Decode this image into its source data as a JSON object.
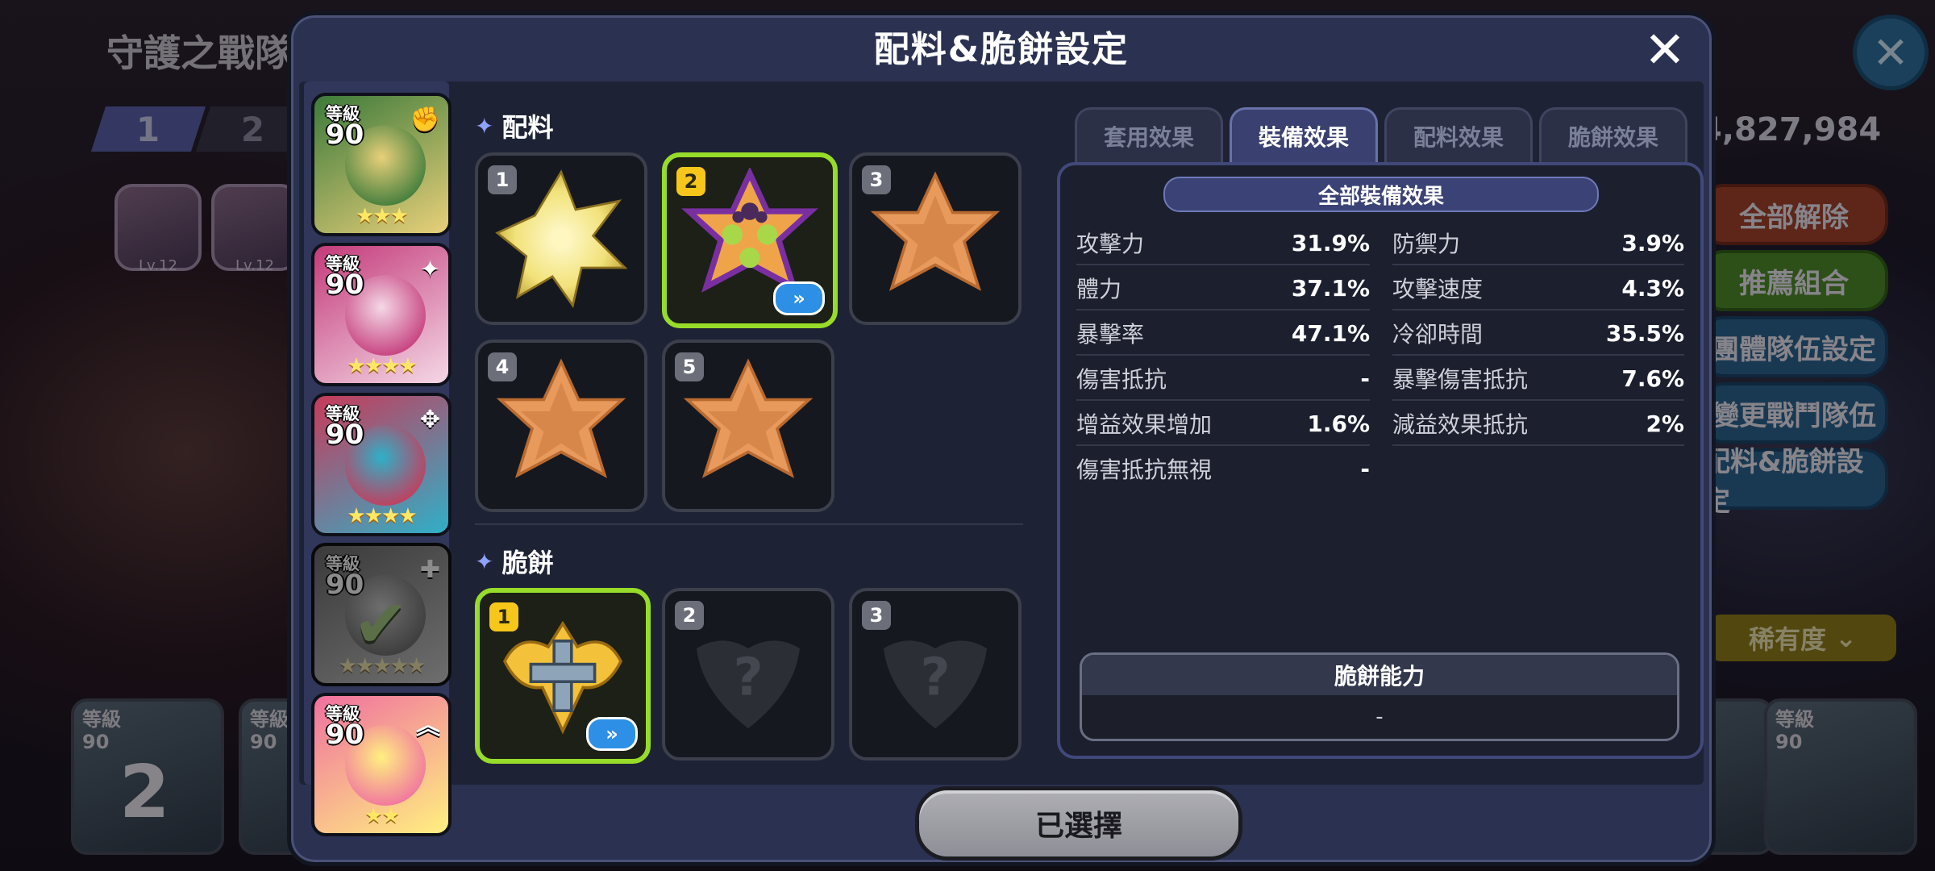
{
  "background": {
    "title": "守護之戰隊",
    "team_tabs": [
      "1",
      "2"
    ],
    "badges": [
      {
        "label": "Lv.12"
      },
      {
        "label": "Lv.12"
      }
    ],
    "coins": "4,827,984",
    "side_buttons": [
      "全部解除",
      "推薦組合",
      "團體隊伍設定",
      "變更戰鬥隊伍",
      "配料&脆餅設定"
    ],
    "rarity_sort": "稀有度",
    "bottom_cards": [
      {
        "level_label": "等級",
        "level": "90",
        "number": "2"
      },
      {
        "level_label": "等級",
        "level": "90"
      },
      {
        "level_label": "等級",
        "level": "90"
      },
      {
        "level_label": "等級",
        "level": "90"
      }
    ]
  },
  "modal": {
    "title": "配料&脆餅設定",
    "close_icon": "close-icon",
    "characters": [
      {
        "level_label": "等級",
        "level": "90",
        "stars": "★★★",
        "palette": [
          "#3c7a3a",
          "#e8d07a"
        ],
        "state": "normal"
      },
      {
        "level_label": "等級",
        "level": "90",
        "stars": "★★★★",
        "palette": [
          "#c43a7a",
          "#f4d8e6"
        ],
        "state": "normal"
      },
      {
        "level_label": "等級",
        "level": "90",
        "stars": "★★★★",
        "palette": [
          "#c83a5a",
          "#2fb0c8"
        ],
        "state": "normal"
      },
      {
        "level_label": "等級",
        "level": "90",
        "stars": "★★★★★",
        "palette": [
          "#6a6a6a",
          "#c8c8c8"
        ],
        "state": "checked"
      },
      {
        "level_label": "等級",
        "level": "90",
        "stars": "★★",
        "palette": [
          "#f070a0",
          "#fff080"
        ],
        "state": "normal"
      }
    ],
    "toppings": {
      "title": "配料",
      "slots": [
        {
          "num": "1",
          "selected": false,
          "kind": "gold-star"
        },
        {
          "num": "2",
          "selected": true,
          "kind": "green-star"
        },
        {
          "num": "3",
          "selected": false,
          "kind": "empty-star"
        },
        {
          "num": "4",
          "selected": false,
          "kind": "empty-star"
        },
        {
          "num": "5",
          "selected": false,
          "kind": "empty-star"
        }
      ]
    },
    "biscuits": {
      "title": "脆餅",
      "slots": [
        {
          "num": "1",
          "selected": true,
          "kind": "gold-cross"
        },
        {
          "num": "2",
          "selected": false,
          "kind": "locked"
        },
        {
          "num": "3",
          "selected": false,
          "kind": "locked"
        }
      ]
    },
    "tabs": [
      {
        "label": "套用效果",
        "active": false
      },
      {
        "label": "裝備效果",
        "active": true
      },
      {
        "label": "配料效果",
        "active": false
      },
      {
        "label": "脆餅效果",
        "active": false
      }
    ],
    "stats": {
      "header": "全部裝備效果",
      "left": [
        {
          "label": "攻擊力",
          "value": "31.9%"
        },
        {
          "label": "體力",
          "value": "37.1%"
        },
        {
          "label": "暴擊率",
          "value": "47.1%"
        },
        {
          "label": "傷害抵抗",
          "value": "-"
        },
        {
          "label": "增益效果增加",
          "value": "1.6%"
        },
        {
          "label": "傷害抵抗無視",
          "value": "-"
        }
      ],
      "right": [
        {
          "label": "防禦力",
          "value": "3.9%"
        },
        {
          "label": "攻擊速度",
          "value": "4.3%"
        },
        {
          "label": "冷卻時間",
          "value": "35.5%"
        },
        {
          "label": "暴擊傷害抵抗",
          "value": "7.6%"
        },
        {
          "label": "減益效果抵抗",
          "value": "2%"
        }
      ]
    },
    "ability": {
      "title": "脆餅能力",
      "value": "-"
    },
    "confirm_label": "已選擇",
    "swap_icon": "double-chevron-right-icon"
  }
}
